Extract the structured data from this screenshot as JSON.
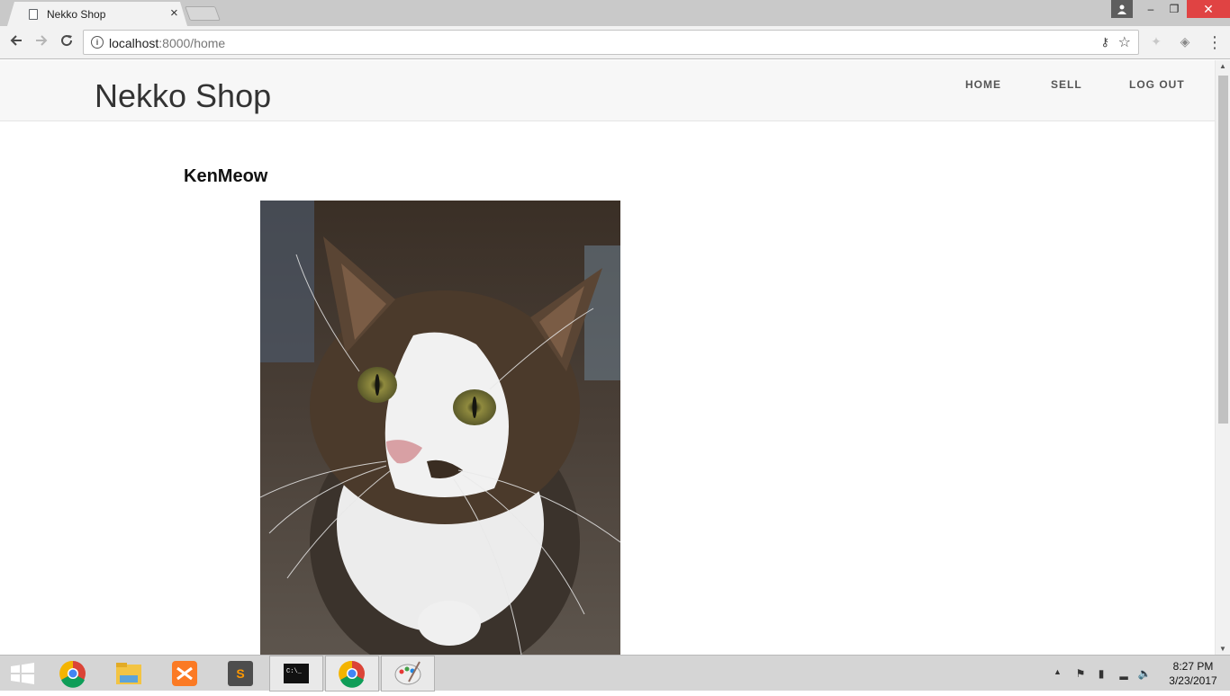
{
  "browser": {
    "tab_title": "Nekko Shop",
    "tab_close": "×",
    "url_host": "localhost",
    "url_path": ":8000/home",
    "window_controls": {
      "minimize": "–",
      "maximize": "❐",
      "close": "✕"
    }
  },
  "site": {
    "brand": "Nekko Shop",
    "nav": [
      {
        "label": "HOME"
      },
      {
        "label": "SELL"
      },
      {
        "label": "LOG OUT"
      }
    ]
  },
  "product": {
    "title": "KenMeow",
    "image_icon": "cat-photo"
  },
  "taskbar": {
    "apps": [
      "windows-start-icon",
      "chrome-icon",
      "file-explorer-icon",
      "xampp-icon",
      "sublime-text-icon",
      "command-prompt-icon",
      "chrome-icon",
      "paint-icon"
    ],
    "clock_time": "8:27 PM",
    "clock_date": "3/23/2017"
  },
  "colors": {
    "header_bg": "#f7f7f7",
    "taskbar_bg": "#d5d5d5",
    "close_red": "#e04343"
  }
}
